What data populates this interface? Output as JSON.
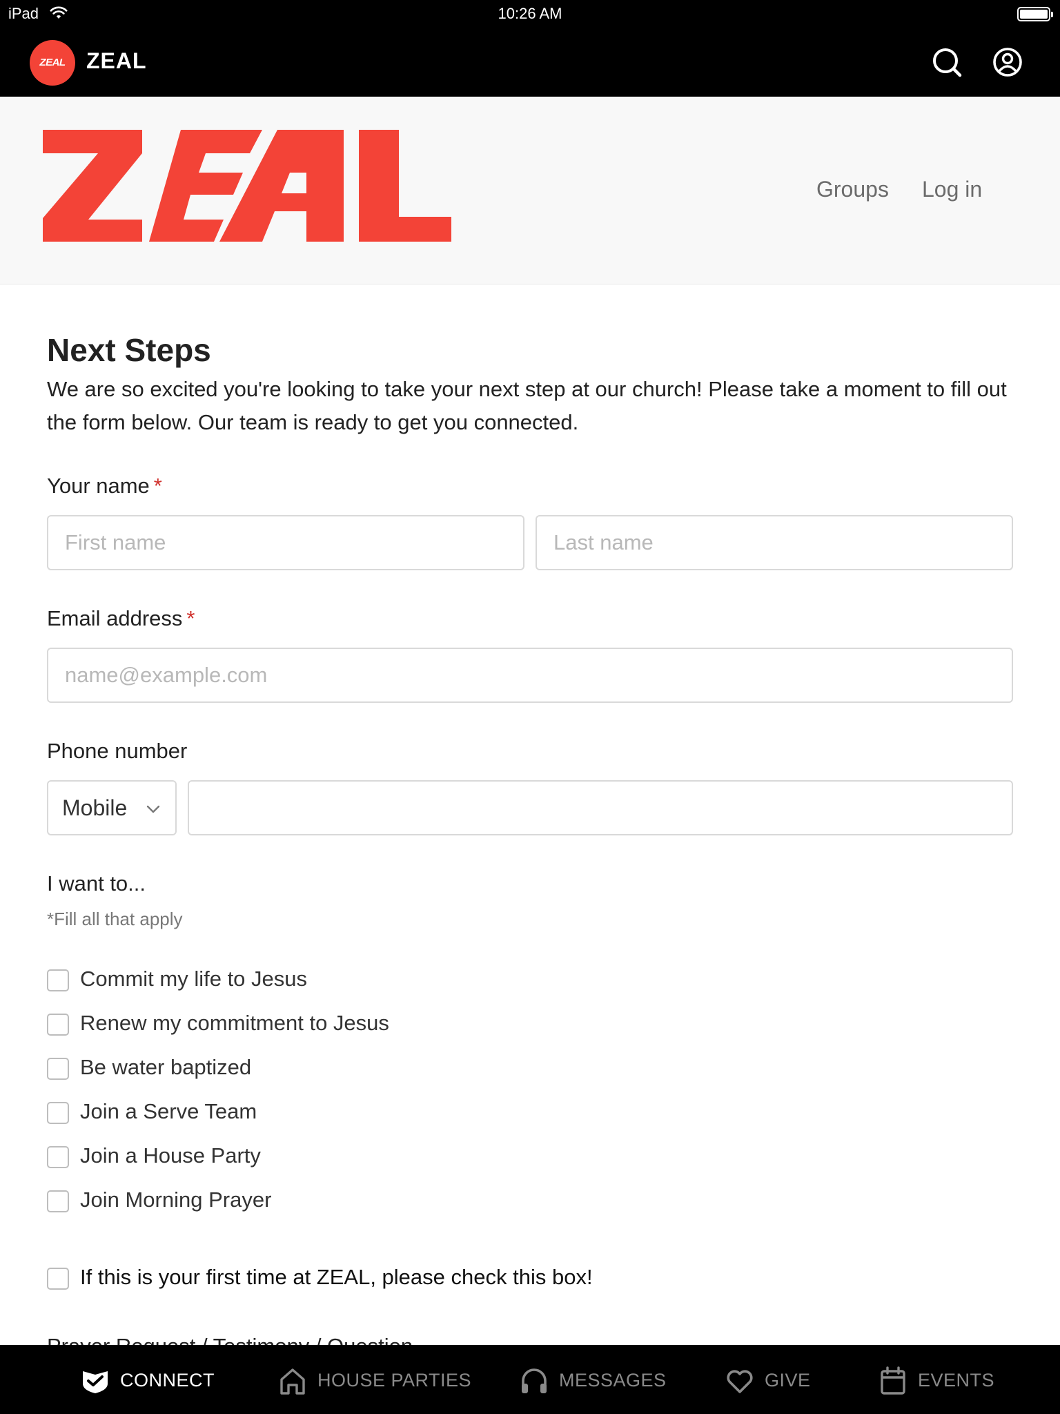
{
  "status_bar": {
    "device": "iPad",
    "time": "10:26 AM",
    "battery_level": 1.0
  },
  "app_header": {
    "badge_text": "ZEAL",
    "title": "ZEAL",
    "search_icon": "search-icon",
    "account_icon": "account-circle-icon"
  },
  "site_header": {
    "logo_text": "ZEAL",
    "nav": {
      "groups": "Groups",
      "login": "Log in"
    }
  },
  "form": {
    "title": "Next Steps",
    "intro": "We are so excited you're looking to take your next step at our church! Please take a moment to fill out the form below. Our team is ready to get you connected.",
    "name": {
      "label": "Your name",
      "required_mark": "*",
      "first_placeholder": "First name",
      "last_placeholder": "Last name",
      "first_value": "",
      "last_value": ""
    },
    "email": {
      "label": "Email address",
      "required_mark": "*",
      "placeholder": "name@example.com",
      "value": ""
    },
    "phone": {
      "label": "Phone number",
      "type_selected": "Mobile",
      "value": ""
    },
    "want_to": {
      "title": "I want to...",
      "hint": "*Fill all that apply",
      "options": [
        {
          "label": "Commit my life to Jesus",
          "checked": false
        },
        {
          "label": "Renew my commitment to Jesus",
          "checked": false
        },
        {
          "label": "Be water baptized",
          "checked": false
        },
        {
          "label": "Join a Serve Team",
          "checked": false
        },
        {
          "label": "Join a House Party",
          "checked": false
        },
        {
          "label": "Join Morning Prayer",
          "checked": false
        }
      ]
    },
    "first_time": {
      "label": "If this is your first time at ZEAL, please check this box!",
      "checked": false
    },
    "next_section_label": "Prayer Request / Testimony / Question"
  },
  "tab_bar": {
    "active_color": "#ffffff",
    "inactive_color": "#8a8a8a",
    "tabs": [
      {
        "label": "CONNECT",
        "icon": "connect-shield-icon",
        "active": true
      },
      {
        "label": "HOUSE PARTIES",
        "icon": "home-icon",
        "active": false
      },
      {
        "label": "MESSAGES",
        "icon": "headphones-icon",
        "active": false
      },
      {
        "label": "GIVE",
        "icon": "heart-icon",
        "active": false
      },
      {
        "label": "EVENTS",
        "icon": "calendar-icon",
        "active": false
      }
    ]
  },
  "colors": {
    "brand_red": "#f34337",
    "required_red": "#d0312d",
    "header_bg": "#000000"
  }
}
